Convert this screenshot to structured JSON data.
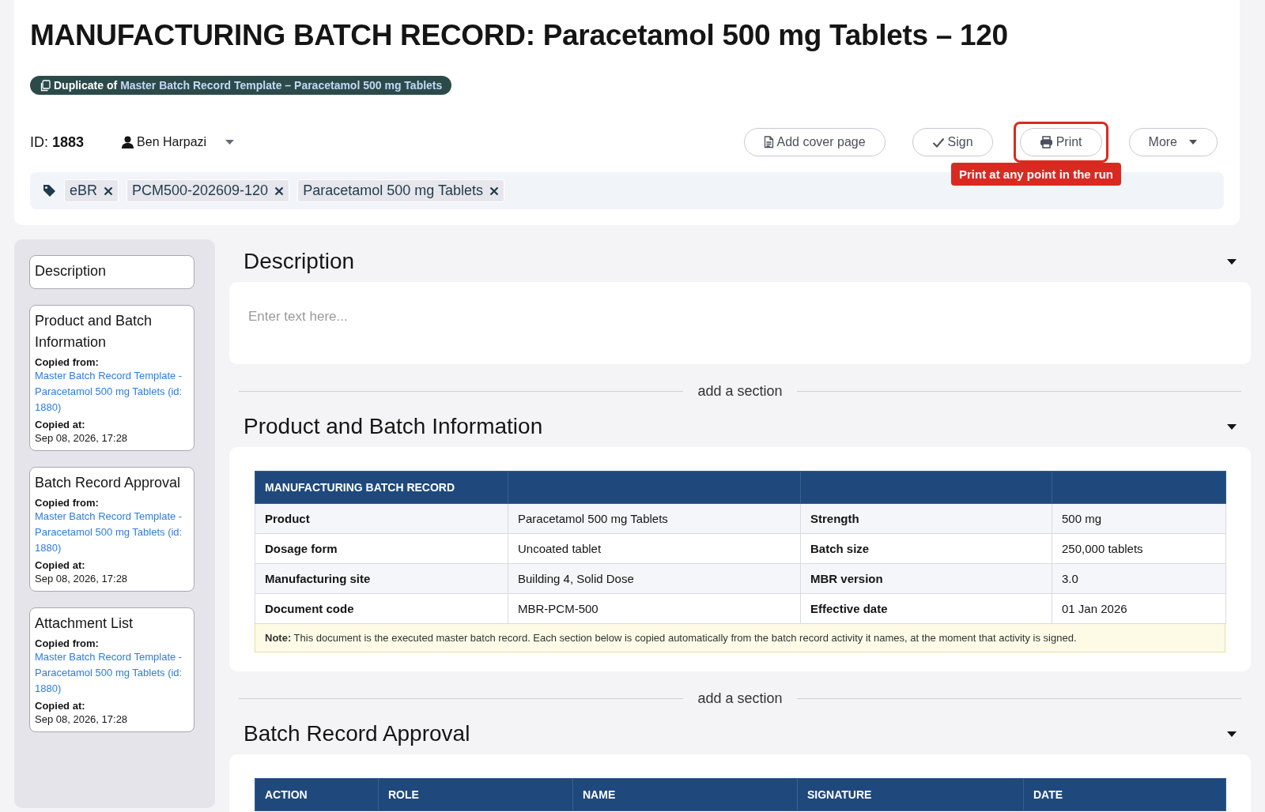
{
  "title": "MANUFACTURING BATCH RECORD: Paracetamol 500 mg Tablets – 120",
  "duplicate_badge": {
    "prefix": "Duplicate of",
    "link": "Master Batch Record Template – Paracetamol 500 mg Tablets"
  },
  "record_id": {
    "label": "ID:",
    "value": "1883"
  },
  "owner": {
    "name": "Ben Harpazi"
  },
  "buttons": [
    {
      "label": "Add cover page",
      "kind": "document",
      "highlighted": false
    },
    {
      "label": "Sign",
      "kind": "check",
      "highlighted": false
    },
    {
      "label": "Print",
      "kind": "printer",
      "highlighted": true
    },
    {
      "label": "More",
      "kind": "dropdown",
      "highlighted": false
    }
  ],
  "tooltip": "Print at any point in the run",
  "tags": [
    "eBR",
    "PCM500-202609-120",
    "Paracetamol 500 mg Tablets"
  ],
  "sidebar": {
    "items": [
      {
        "title": "Description"
      },
      {
        "title": "Product and Batch Information",
        "copied_from_label": "Copied from:",
        "copied_from": "Master Batch Record Template - Paracetamol 500 mg Tablets (id: 1880)",
        "copied_at_label": "Copied at:",
        "copied_at": "Sep 08, 2026, 17:28"
      },
      {
        "title": "Batch Record Approval",
        "copied_from_label": "Copied from:",
        "copied_from": "Master Batch Record Template - Paracetamol 500 mg Tablets (id: 1880)",
        "copied_at_label": "Copied at:",
        "copied_at": "Sep 08, 2026, 17:28"
      },
      {
        "title": "Attachment List",
        "copied_from_label": "Copied from:",
        "copied_from": "Master Batch Record Template - Paracetamol 500 mg Tablets (id: 1880)",
        "copied_at_label": "Copied at:",
        "copied_at": "Sep 08, 2026, 17:28"
      }
    ]
  },
  "sections": [
    {
      "kind": "text",
      "title": "Description",
      "expanded": true,
      "placeholder": "Enter text here..."
    },
    {
      "kind": "table",
      "title": "Product and Batch Information",
      "expanded": true,
      "add_link": "add a section",
      "table": {
        "columns": [
          "MANUFACTURING BATCH RECORD"
        ],
        "rows": [
          [
            "Product",
            "Paracetamol 500 mg Tablets",
            "Strength",
            "500 mg"
          ],
          [
            "Dosage form",
            "Uncoated tablet",
            "Batch size",
            "250,000 tablets"
          ],
          [
            "Manufacturing site",
            "Building 4, Solid Dose",
            "MBR version",
            "3.0"
          ],
          [
            "Document code",
            "MBR-PCM-500",
            "Effective date",
            "01 Jan 2026"
          ]
        ],
        "note": "**Note:** This document is the executed master batch record. Each section below is copied automatically from the batch record activity it names, at the moment that activity is signed."
      }
    },
    {
      "kind": "table",
      "title": "Batch Record Approval",
      "expanded": true,
      "add_link": "add a section",
      "table": {
        "columns": [
          "ACTION",
          "ROLE",
          "NAME",
          "SIGNATURE",
          "DATE"
        ]
      }
    }
  ]
}
